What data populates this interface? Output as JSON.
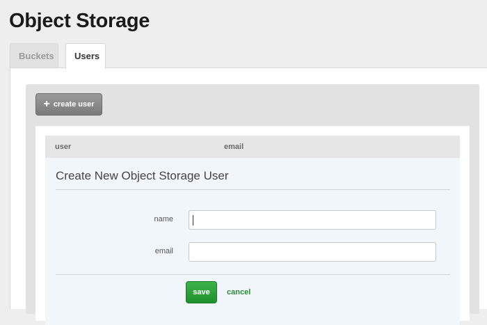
{
  "page": {
    "title": "Object Storage"
  },
  "tabs": [
    {
      "label": "Buckets",
      "active": false
    },
    {
      "label": "Users",
      "active": true
    }
  ],
  "toolbar": {
    "create_user_icon": "plus-icon",
    "create_user_label": "create user"
  },
  "table": {
    "columns": [
      "user",
      "email"
    ]
  },
  "form": {
    "title": "Create New Object Storage User",
    "name_label": "name",
    "name_value": "",
    "email_label": "email",
    "email_value": "",
    "save_label": "save",
    "cancel_label": "cancel"
  },
  "colors": {
    "accent_green": "#2a8a35",
    "button_gray": "#8a8a8a",
    "form_bg": "#f0f6fa"
  }
}
